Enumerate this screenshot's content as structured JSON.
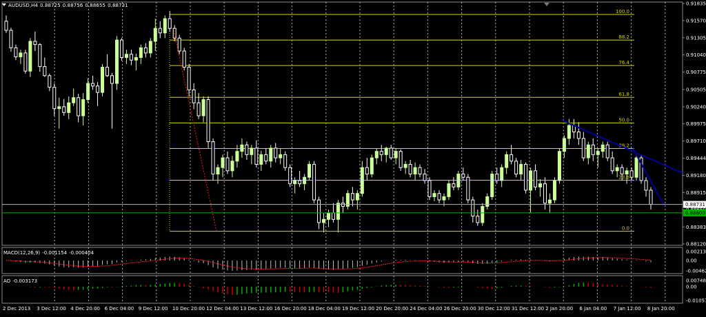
{
  "header": {
    "symbol": "AUDUSD,H4",
    "ohlc": [
      "0.88725",
      "0.88756",
      "0.88655",
      "0.88731"
    ]
  },
  "colors": {
    "background": "#000000",
    "frame": "#8c8c8c",
    "grid": "#b4b4b4",
    "bull_candle": "#ccff99",
    "bear_candle": "#ffffff",
    "fib": "#d6d600",
    "trend": "#000099",
    "dotted_trend": "#ff1a1a",
    "bid_line": "#b4b4b4",
    "ask_line": "#00b400",
    "macd_hist": "#c0c0c0",
    "macd_signal": "#ff2222",
    "ao_up": "#00aa00",
    "ao_down": "#cc0000"
  },
  "price_axis": {
    "ticks": [
      "0.91835",
      "0.91570",
      "0.91305",
      "0.91040",
      "0.90775",
      "0.90505",
      "0.90240",
      "0.89975",
      "0.89710",
      "0.89444",
      "0.89180",
      "0.88915",
      "0.88650",
      "0.88383",
      "0.88120"
    ],
    "current_bid": "0.88731",
    "ask_marker": "0.88600"
  },
  "time_axis": {
    "labels": [
      "2 Dec 2013",
      "3 Dec 12:00",
      "4 Dec 20:00",
      "6 Dec 04:00",
      "9 Dec 12:00",
      "10 Dec 20:00",
      "12 Dec 04:00",
      "13 Dec 12:00",
      "16 Dec 20:00",
      "18 Dec 04:00",
      "19 Dec 12:00",
      "20 Dec 20:00",
      "24 Dec 04:00",
      "26 Dec 20:00",
      "30 Dec 12:00",
      "31 Dec 12:00",
      "2 Jan 20:00",
      "6 Jan 04:00",
      "7 Jan 12:00",
      "8 Jan 20:00"
    ]
  },
  "fibonacci": {
    "levels": [
      {
        "label": "100.0",
        "price": 0.91665
      },
      {
        "label": "88.2",
        "price": 0.9127
      },
      {
        "label": "76.4",
        "price": 0.90875
      },
      {
        "label": "61.8",
        "price": 0.90385
      },
      {
        "label": "50.0",
        "price": 0.8999
      },
      {
        "label": "38.2",
        "price": 0.89594
      },
      {
        "label": "23.6",
        "price": 0.89105
      },
      {
        "label": "0.0",
        "price": 0.88315
      }
    ]
  },
  "indicators": {
    "macd": {
      "label": "MACD(12,26,9)",
      "values": [
        "-0.001154",
        "-0.000404"
      ],
      "ticks": [
        "0.002131",
        "0.00",
        "-0.004624"
      ]
    },
    "ao": {
      "label": "AO",
      "value": "-0.003173",
      "ticks": [
        "0.007482",
        "0.00",
        "-0.010571"
      ]
    }
  },
  "chart_data": {
    "type": "candlestick",
    "title": "AUDUSD,H4",
    "xlabel": "",
    "ylabel": "",
    "ylim": [
      0.8812,
      0.91835
    ],
    "grid": true,
    "series": [
      {
        "values": [
          [
            0.9156,
            0.9165,
            0.9138,
            0.9142
          ],
          [
            0.9142,
            0.9146,
            0.9109,
            0.9115
          ],
          [
            0.9115,
            0.912,
            0.9096,
            0.9101
          ],
          [
            0.9101,
            0.9112,
            0.909,
            0.9107
          ],
          [
            0.9107,
            0.9112,
            0.9075,
            0.9079
          ],
          [
            0.9079,
            0.913,
            0.907,
            0.9125
          ],
          [
            0.9125,
            0.914,
            0.911,
            0.912
          ],
          [
            0.912,
            0.9122,
            0.9078,
            0.9086
          ],
          [
            0.9086,
            0.91,
            0.907,
            0.9072
          ],
          [
            0.9072,
            0.9075,
            0.9048,
            0.9054
          ],
          [
            0.9054,
            0.906,
            0.901,
            0.9021
          ],
          [
            0.9021,
            0.9038,
            0.899,
            0.9024
          ],
          [
            0.9024,
            0.9036,
            0.901,
            0.9015
          ],
          [
            0.9015,
            0.904,
            0.9005,
            0.903
          ],
          [
            0.903,
            0.9052,
            0.9025,
            0.9038
          ],
          [
            0.9038,
            0.9044,
            0.9,
            0.901
          ],
          [
            0.901,
            0.9045,
            0.8995,
            0.9035
          ],
          [
            0.9035,
            0.9068,
            0.903,
            0.906
          ],
          [
            0.906,
            0.9072,
            0.905,
            0.9056
          ],
          [
            0.9056,
            0.9062,
            0.9025,
            0.9046
          ],
          [
            0.9046,
            0.909,
            0.904,
            0.9085
          ],
          [
            0.9085,
            0.9105,
            0.907,
            0.9072
          ],
          [
            0.9072,
            0.9076,
            0.899,
            0.906
          ],
          [
            0.906,
            0.9133,
            0.905,
            0.9127
          ],
          [
            0.9127,
            0.913,
            0.9095,
            0.91
          ],
          [
            0.91,
            0.9112,
            0.909,
            0.9105
          ],
          [
            0.9105,
            0.9112,
            0.9088,
            0.9096
          ],
          [
            0.9096,
            0.9106,
            0.908,
            0.91
          ],
          [
            0.91,
            0.912,
            0.909,
            0.9115
          ],
          [
            0.9115,
            0.9122,
            0.91,
            0.9107
          ],
          [
            0.9107,
            0.913,
            0.91,
            0.9125
          ],
          [
            0.9125,
            0.916,
            0.911,
            0.9145
          ],
          [
            0.9145,
            0.9156,
            0.913,
            0.9138
          ],
          [
            0.9138,
            0.9165,
            0.913,
            0.916
          ],
          [
            0.916,
            0.9172,
            0.914,
            0.9145
          ],
          [
            0.9145,
            0.915,
            0.9125,
            0.913
          ],
          [
            0.913,
            0.9135,
            0.9105,
            0.911
          ],
          [
            0.911,
            0.9115,
            0.908,
            0.9085
          ],
          [
            0.9085,
            0.909,
            0.904,
            0.905
          ],
          [
            0.905,
            0.906,
            0.902,
            0.903
          ],
          [
            0.903,
            0.9045,
            0.9005,
            0.901
          ],
          [
            0.901,
            0.904,
            0.9,
            0.9035
          ],
          [
            0.9035,
            0.904,
            0.896,
            0.897
          ],
          [
            0.897,
            0.8975,
            0.891,
            0.892
          ],
          [
            0.892,
            0.8935,
            0.8905,
            0.893
          ],
          [
            0.893,
            0.895,
            0.8915,
            0.8945
          ],
          [
            0.8945,
            0.8955,
            0.892,
            0.8925
          ],
          [
            0.8925,
            0.8948,
            0.8915,
            0.894
          ],
          [
            0.894,
            0.8965,
            0.893,
            0.8955
          ],
          [
            0.8955,
            0.8975,
            0.8945,
            0.8965
          ],
          [
            0.8965,
            0.897,
            0.8942,
            0.895
          ],
          [
            0.895,
            0.8965,
            0.8935,
            0.896
          ],
          [
            0.896,
            0.8972,
            0.893,
            0.8935
          ],
          [
            0.8935,
            0.8956,
            0.8925,
            0.895
          ],
          [
            0.895,
            0.896,
            0.8935,
            0.894
          ],
          [
            0.894,
            0.8965,
            0.893,
            0.896
          ],
          [
            0.896,
            0.8968,
            0.8938,
            0.8945
          ],
          [
            0.8945,
            0.896,
            0.8935,
            0.895
          ],
          [
            0.895,
            0.8955,
            0.8925,
            0.893
          ],
          [
            0.893,
            0.8935,
            0.89,
            0.8905
          ],
          [
            0.8905,
            0.8915,
            0.889,
            0.891
          ],
          [
            0.891,
            0.8925,
            0.89,
            0.8905
          ],
          [
            0.8905,
            0.892,
            0.8895,
            0.8915
          ],
          [
            0.8915,
            0.894,
            0.891,
            0.8935
          ],
          [
            0.8935,
            0.894,
            0.8875,
            0.888
          ],
          [
            0.888,
            0.8885,
            0.8835,
            0.8845
          ],
          [
            0.8845,
            0.886,
            0.883,
            0.885
          ],
          [
            0.885,
            0.8865,
            0.8838,
            0.886
          ],
          [
            0.886,
            0.8875,
            0.8845,
            0.885
          ],
          [
            0.885,
            0.888,
            0.883,
            0.8875
          ],
          [
            0.8875,
            0.8885,
            0.886,
            0.887
          ],
          [
            0.887,
            0.8895,
            0.8865,
            0.889
          ],
          [
            0.889,
            0.89,
            0.887,
            0.888
          ],
          [
            0.888,
            0.8895,
            0.8865,
            0.889
          ],
          [
            0.889,
            0.894,
            0.8885,
            0.893
          ],
          [
            0.893,
            0.8945,
            0.891,
            0.892
          ],
          [
            0.892,
            0.895,
            0.8915,
            0.8945
          ],
          [
            0.8945,
            0.896,
            0.8935,
            0.8955
          ],
          [
            0.8955,
            0.8965,
            0.894,
            0.895
          ],
          [
            0.895,
            0.8962,
            0.8938,
            0.896
          ],
          [
            0.896,
            0.8965,
            0.8942,
            0.8945
          ],
          [
            0.8945,
            0.896,
            0.8935,
            0.8955
          ],
          [
            0.8955,
            0.8958,
            0.8925,
            0.893
          ],
          [
            0.893,
            0.894,
            0.892,
            0.8935
          ],
          [
            0.8935,
            0.8942,
            0.8915,
            0.892
          ],
          [
            0.892,
            0.8938,
            0.891,
            0.893
          ],
          [
            0.893,
            0.8935,
            0.8915,
            0.892
          ],
          [
            0.892,
            0.8928,
            0.8905,
            0.891
          ],
          [
            0.891,
            0.8915,
            0.888,
            0.8885
          ],
          [
            0.8885,
            0.8895,
            0.8878,
            0.889
          ],
          [
            0.889,
            0.8895,
            0.8875,
            0.888
          ],
          [
            0.888,
            0.889,
            0.887,
            0.8885
          ],
          [
            0.8885,
            0.891,
            0.888,
            0.8905
          ],
          [
            0.8905,
            0.8915,
            0.8895,
            0.89
          ],
          [
            0.89,
            0.8925,
            0.8895,
            0.892
          ],
          [
            0.892,
            0.893,
            0.891,
            0.8915
          ],
          [
            0.8915,
            0.892,
            0.8875,
            0.888
          ],
          [
            0.888,
            0.8885,
            0.8845,
            0.8855
          ],
          [
            0.8855,
            0.8865,
            0.884,
            0.8845
          ],
          [
            0.8845,
            0.8875,
            0.884,
            0.887
          ],
          [
            0.887,
            0.889,
            0.8865,
            0.8885
          ],
          [
            0.8885,
            0.8925,
            0.888,
            0.892
          ],
          [
            0.892,
            0.893,
            0.8905,
            0.891
          ],
          [
            0.891,
            0.8935,
            0.89,
            0.893
          ],
          [
            0.893,
            0.8955,
            0.892,
            0.895
          ],
          [
            0.895,
            0.8965,
            0.8935,
            0.894
          ],
          [
            0.894,
            0.8945,
            0.8915,
            0.892
          ],
          [
            0.892,
            0.8942,
            0.891,
            0.8935
          ],
          [
            0.8935,
            0.8938,
            0.889,
            0.8895
          ],
          [
            0.8895,
            0.893,
            0.886,
            0.8925
          ],
          [
            0.8925,
            0.8935,
            0.8895,
            0.89
          ],
          [
            0.89,
            0.8912,
            0.8885,
            0.8905
          ],
          [
            0.8905,
            0.8915,
            0.8865,
            0.8875
          ],
          [
            0.8875,
            0.889,
            0.886,
            0.888
          ],
          [
            0.888,
            0.8915,
            0.8875,
            0.891
          ],
          [
            0.891,
            0.896,
            0.8905,
            0.8955
          ],
          [
            0.8955,
            0.898,
            0.8945,
            0.8975
          ],
          [
            0.8975,
            0.9005,
            0.8965,
            0.8995
          ],
          [
            0.8995,
            0.9005,
            0.8975,
            0.8985
          ],
          [
            0.8985,
            0.9,
            0.8965,
            0.8975
          ],
          [
            0.8975,
            0.8985,
            0.894,
            0.8945
          ],
          [
            0.8945,
            0.897,
            0.8935,
            0.8965
          ],
          [
            0.8965,
            0.8975,
            0.894,
            0.895
          ],
          [
            0.895,
            0.896,
            0.893,
            0.8955
          ],
          [
            0.8955,
            0.897,
            0.8945,
            0.8965
          ],
          [
            0.8965,
            0.897,
            0.894,
            0.8945
          ],
          [
            0.8945,
            0.8955,
            0.892,
            0.8925
          ],
          [
            0.8925,
            0.8935,
            0.8915,
            0.893
          ],
          [
            0.893,
            0.8935,
            0.891,
            0.892
          ],
          [
            0.892,
            0.893,
            0.8905,
            0.8925
          ],
          [
            0.8925,
            0.893,
            0.891,
            0.8915
          ],
          [
            0.8915,
            0.895,
            0.891,
            0.8945
          ],
          [
            0.8945,
            0.895,
            0.8905,
            0.891
          ],
          [
            0.891,
            0.8915,
            0.8885,
            0.8895
          ],
          [
            0.8895,
            0.89,
            0.8865,
            0.88731
          ]
        ]
      }
    ],
    "fib_range": [
      0.91665,
      0.88315
    ],
    "trendlines": [
      "descending trendline from 2 Jan 20:00 high",
      "steep descending line toward 8 Jan 20:00 low",
      "dotted descending line from 10 Dec 20:00 to 12 Dec 04:00"
    ]
  }
}
